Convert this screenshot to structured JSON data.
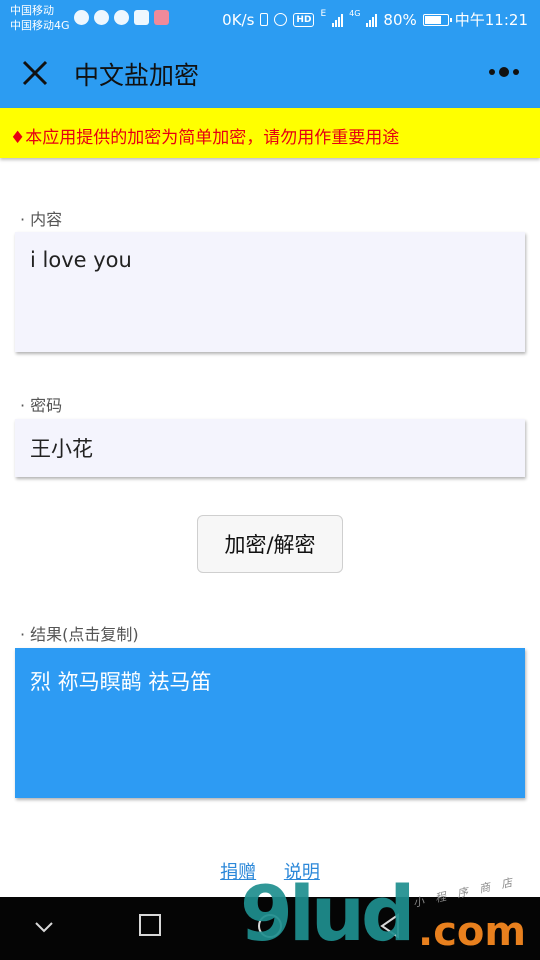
{
  "status_bar": {
    "carrier_1": "中国移动",
    "carrier_2": "中国移动4G",
    "net_speed": "0K/s",
    "hd_badge": "HD",
    "lte_tag": "E",
    "net_4g": "4G",
    "battery": "80%",
    "time": "中午11:21",
    "app_icons": [
      "wechat-icon",
      "app-icon",
      "message-icon",
      "calendar-icon",
      "mail-icon"
    ],
    "battery_level": 0.8
  },
  "header": {
    "title": "中文盐加密",
    "close_icon": "close-icon",
    "more_icon": "more-icon"
  },
  "banner": {
    "text": "♦本应用提供的加密为简单加密，请勿用作重要用途",
    "color": "#e60012",
    "background": "#ffff00"
  },
  "form": {
    "content_label": "· 内容",
    "content_value": "i love you",
    "password_label": "· 密码",
    "password_value": "王小花",
    "button_label": "加密/解密",
    "result_label": "· 结果(点击复制)",
    "result_value": "烈 祢马瞑鹋 祛马笛"
  },
  "footer_links": {
    "donate": "捐赠",
    "help": "说明"
  },
  "nav_bar": {
    "icons": [
      "chevron-down-icon",
      "square-icon",
      "circle-icon",
      "back-triangle-icon"
    ]
  },
  "watermark": {
    "main": "9lud",
    "domain": ".com",
    "sub": "小 程 序 商 店"
  },
  "colors": {
    "accent": "#2c9cf2",
    "result_box": "#2d9bf3",
    "input_bg": "#f4f4fd",
    "link": "#2c88d9"
  }
}
